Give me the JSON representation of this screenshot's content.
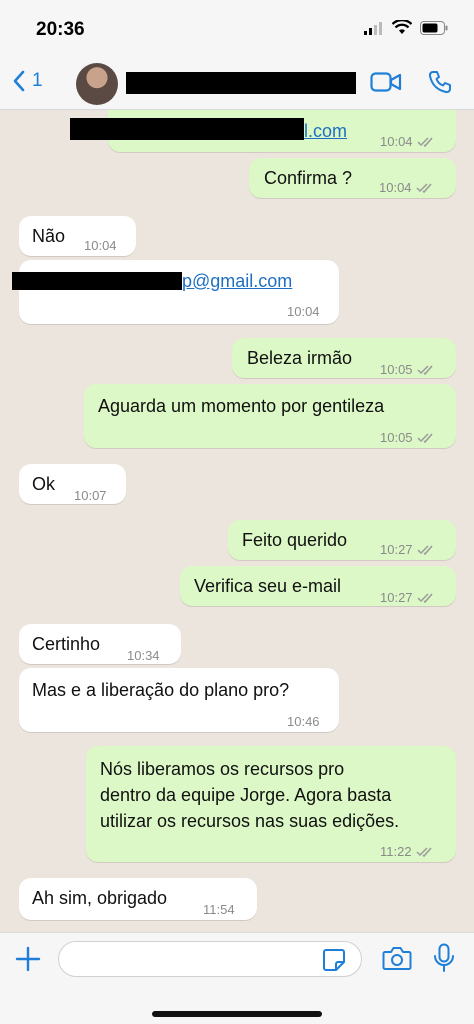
{
  "status_bar": {
    "time": "20:36"
  },
  "header": {
    "back_count": "1",
    "contact_name": "",
    "redacted": true
  },
  "messages": [
    {
      "dir": "out",
      "text": "l.com",
      "link": true,
      "time": "10:04"
    },
    {
      "dir": "out",
      "text": "Confirma ?",
      "time": "10:04"
    },
    {
      "dir": "in",
      "text": "Não",
      "time": "10:04"
    },
    {
      "dir": "in",
      "text": "p@gmail.com",
      "link": true,
      "time": "10:04"
    },
    {
      "dir": "out",
      "text": "Beleza irmão",
      "time": "10:05"
    },
    {
      "dir": "out",
      "text": "Aguarda um momento por gentileza",
      "time": "10:05"
    },
    {
      "dir": "in",
      "text": "Ok",
      "time": "10:07"
    },
    {
      "dir": "out",
      "text": "Feito querido",
      "time": "10:27"
    },
    {
      "dir": "out",
      "text": "Verifica seu e-mail",
      "time": "10:27"
    },
    {
      "dir": "in",
      "text": "Certinho",
      "time": "10:34"
    },
    {
      "dir": "in",
      "text": "Mas e a liberação do plano pro?",
      "time": "10:46"
    },
    {
      "dir": "out",
      "text_lines": [
        "Nós liberamos os recursos pro",
        "dentro da equipe Jorge. Agora basta",
        "utilizar os recursos nas suas edições."
      ],
      "time": "11:22"
    },
    {
      "dir": "in",
      "text": "Ah sim, obrigado",
      "time": "11:54"
    }
  ],
  "colors": {
    "outgoing_bubble": "#dcf8c6",
    "incoming_bubble": "#ffffff",
    "chat_bg": "#ece5dd",
    "accent": "#1f7fd8"
  },
  "icons": [
    "back-chevron-icon",
    "video-call-icon",
    "phone-icon",
    "plus-icon",
    "sticker-icon",
    "camera-icon",
    "mic-icon",
    "double-check-icon"
  ]
}
